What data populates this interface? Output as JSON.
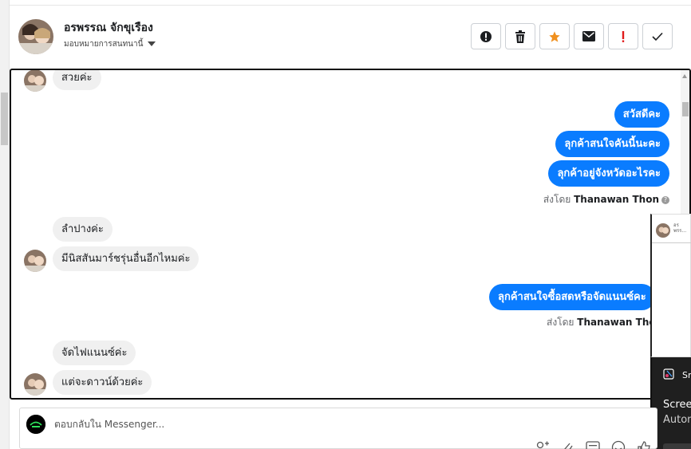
{
  "colors": {
    "accent": "#0a7cff",
    "incoming_bg": "#f0f0f0",
    "star": "#f0901e",
    "alert": "#e01b1b"
  },
  "header": {
    "contact_name": "อรพรรณ จักขุเรือง",
    "assign_label": "มอบหมายการสนทนานี้",
    "actions": [
      {
        "name": "report-spam",
        "icon": "exclamation-circle-icon"
      },
      {
        "name": "delete",
        "icon": "trash-icon"
      },
      {
        "name": "star",
        "icon": "star-icon"
      },
      {
        "name": "mark-unread",
        "icon": "envelope-icon"
      },
      {
        "name": "priority",
        "icon": "exclamation-icon"
      },
      {
        "name": "done",
        "icon": "check-icon"
      }
    ]
  },
  "messages": [
    {
      "from": "customer",
      "text": "สวยค่ะ"
    },
    {
      "from": "page",
      "text": "สวัสดีคะ"
    },
    {
      "from": "page",
      "text": "ลุกค้าสนใจคันนี้นะคะ"
    },
    {
      "from": "page",
      "text": "ลุกค้าอยู่จังหวัดอะไรคะ"
    },
    {
      "from": "page_meta",
      "sent_prefix": "ส่งโดย",
      "sender": "Thanawan Thon"
    },
    {
      "from": "customer",
      "text": "ลำปางค่ะ"
    },
    {
      "from": "customer",
      "text": "มีนิสสันมาร์ชรุ่นอื่นอีกไหมค่ะ"
    },
    {
      "from": "page",
      "text": "ลุกค้าสนใจซื้อสดหรือจัดแนนซ์คะ"
    },
    {
      "from": "page_meta",
      "sent_prefix": "ส่งโดย",
      "sender": "Thanawan Thon"
    },
    {
      "from": "customer",
      "text": "จัดไฟแนนซ์ค่ะ"
    },
    {
      "from": "customer",
      "text": "แต่จะดาวน์ด้วยค่ะ"
    }
  ],
  "popup": {
    "mini_title": "อรพรร..."
  },
  "notification": {
    "app": "Sn",
    "title": "Scree",
    "subtitle": "Autom"
  },
  "composer": {
    "placeholder": "ตอบกลับใน Messenger..."
  }
}
